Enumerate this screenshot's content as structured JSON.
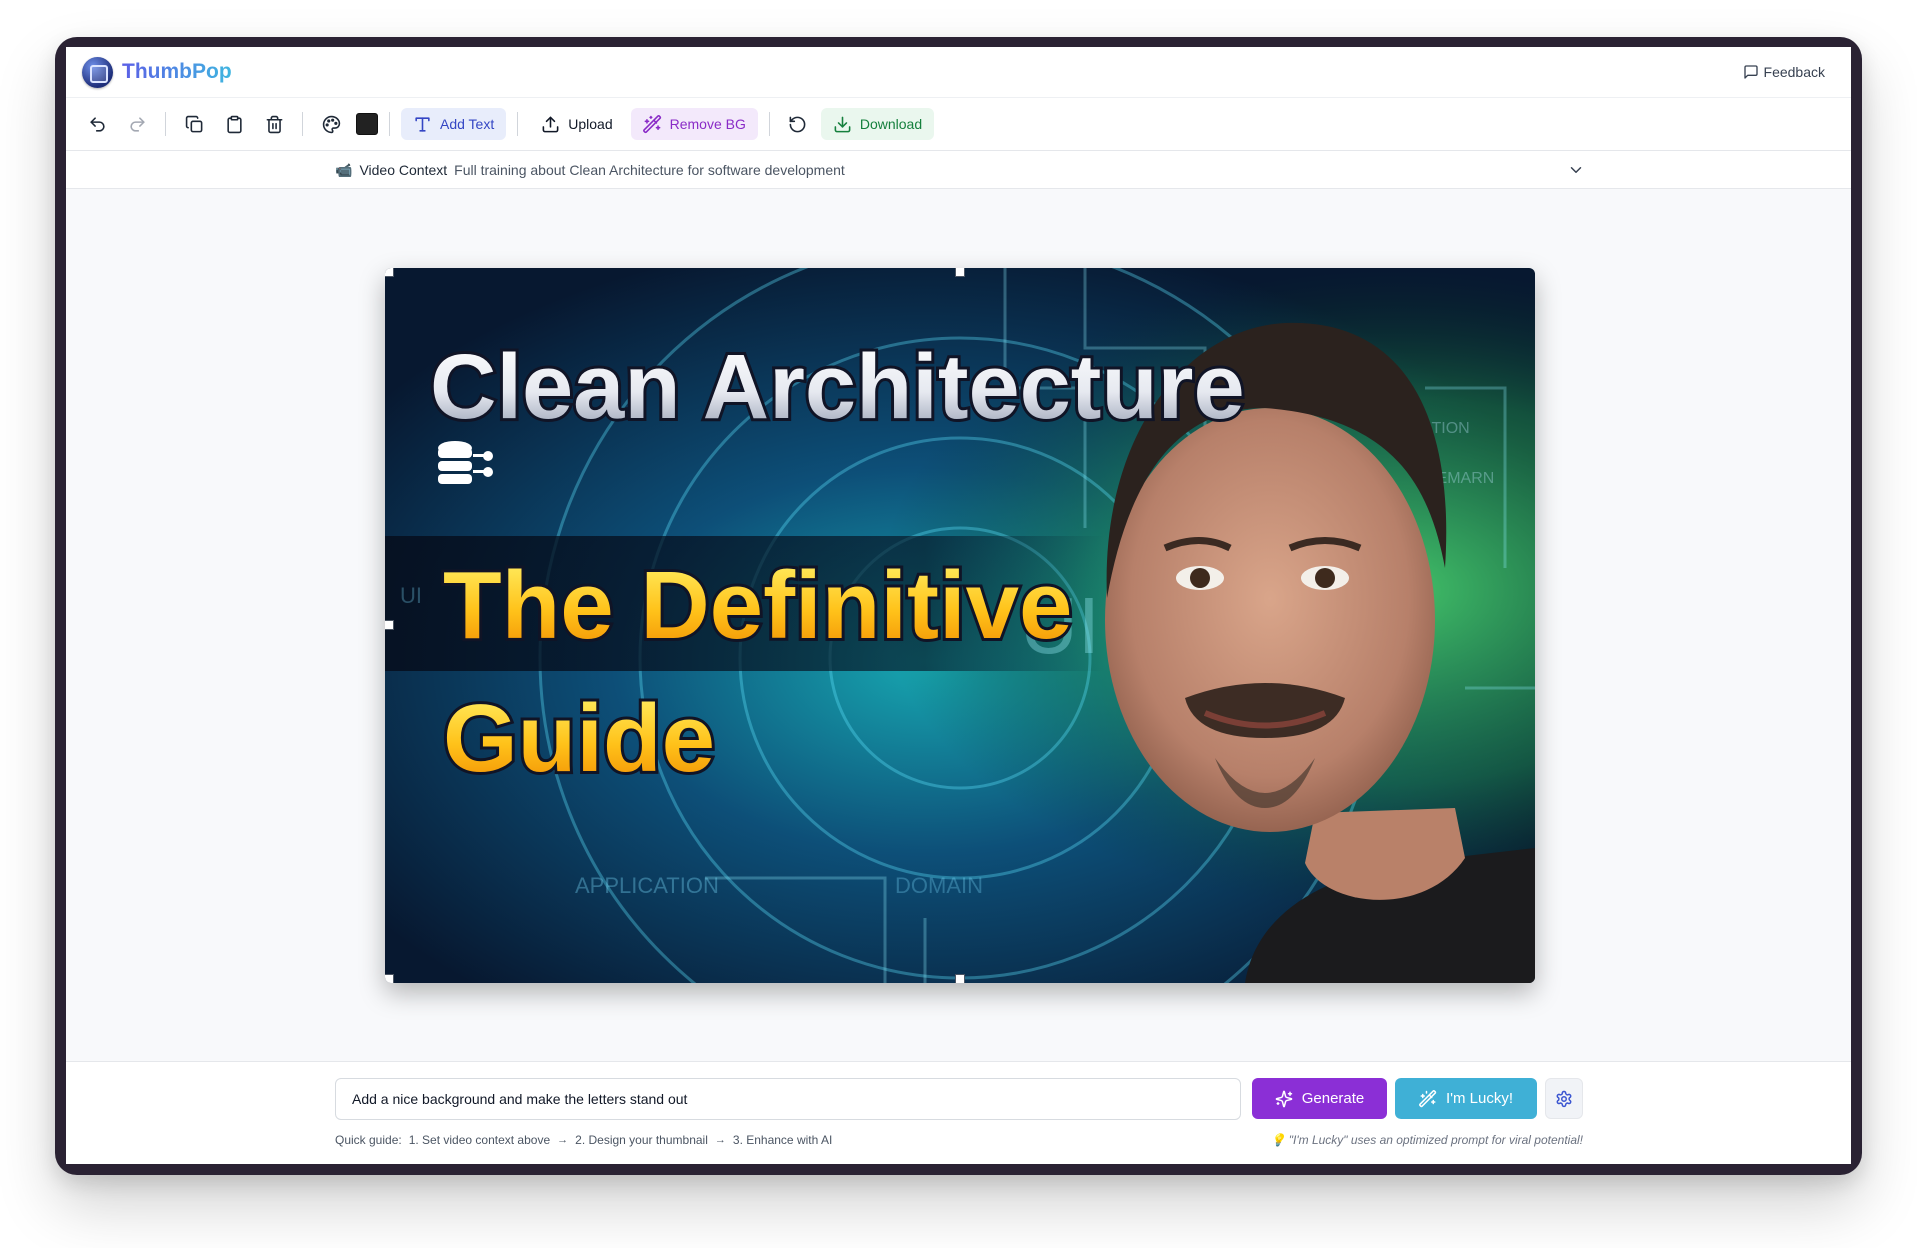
{
  "app": {
    "name": "ThumbPop",
    "feedback_label": "Feedback"
  },
  "toolbar": {
    "add_text_label": "Add Text",
    "upload_label": "Upload",
    "remove_bg_label": "Remove BG",
    "download_label": "Download",
    "text_color": "#222222"
  },
  "context": {
    "icon": "📹",
    "label": "Video Context",
    "value": "Full training about Clean Architecture for software development"
  },
  "thumbnail": {
    "line1": "Clean Architecture",
    "line2": "The Definitive",
    "line3": "Guide",
    "bg_label_1": "APPLICATION",
    "bg_label_2": "DOMAIN",
    "bg_label_3": "UI",
    "bg_label_4": "UI",
    "bg_label_5": "ATION",
    "bg_label_6": "DEMARN"
  },
  "prompt": {
    "value": "Add a nice background and make the letters stand out",
    "generate_label": "Generate",
    "lucky_label": "I'm Lucky!"
  },
  "guide": {
    "label": "Quick guide:",
    "step1": "1. Set video context above",
    "step2": "2. Design your thumbnail",
    "step3": "3. Enhance with AI",
    "arrow": "→"
  },
  "lucky_note": "💡 \"I'm Lucky\" uses an optimized prompt for viral potential!",
  "colors": {
    "brand_from": "#5b5fe6",
    "brand_to": "#3fb6e0",
    "generate": "#8b2fd6",
    "lucky": "#3fb0d6",
    "download": "#15803d",
    "remove_bg": "#8a2bc7",
    "add_text": "#3446c4"
  }
}
